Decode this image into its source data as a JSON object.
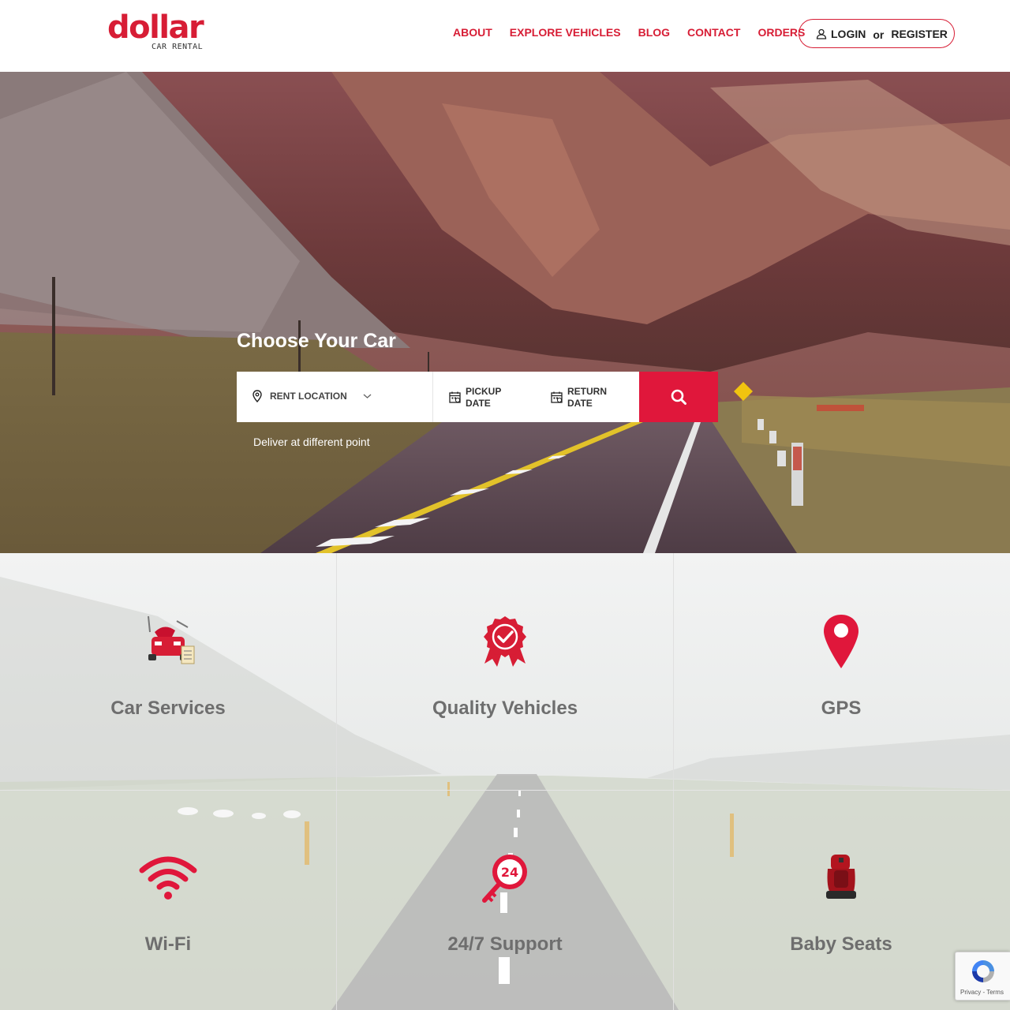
{
  "brand": {
    "name": "dollar",
    "tagline": "CAR RENTAL",
    "color": "#d71d35"
  },
  "nav": {
    "items": [
      {
        "label": "ABOUT"
      },
      {
        "label": "EXPLORE VEHICLES"
      },
      {
        "label": "BLOG"
      },
      {
        "label": "CONTACT"
      },
      {
        "label": "ORDERS"
      }
    ]
  },
  "auth": {
    "login_label": "LOGIN",
    "or_label": "or",
    "register_label": "REGISTER",
    "icon": "user-icon"
  },
  "hero": {
    "title": "Choose Your Car",
    "search": {
      "location_placeholder": "RENT LOCATION",
      "pickup_line1": "PICKUP",
      "pickup_line2": "DATE",
      "return_line1": "RETURN",
      "return_line2": "DATE",
      "search_icon": "search-icon",
      "button_color": "#e0173b"
    },
    "deliver_label": "Deliver at different point"
  },
  "features": [
    {
      "label": "Car Services",
      "icon": "car-service-icon"
    },
    {
      "label": "Quality Vehicles",
      "icon": "quality-badge-icon"
    },
    {
      "label": "GPS",
      "icon": "map-pin-icon"
    },
    {
      "label": "Wi-Fi",
      "icon": "wifi-icon"
    },
    {
      "label": "24/7 Support",
      "icon": "support-24-icon"
    },
    {
      "label": "Baby Seats",
      "icon": "baby-seat-icon"
    }
  ],
  "recaptcha": {
    "terms": "Privacy - Terms"
  }
}
